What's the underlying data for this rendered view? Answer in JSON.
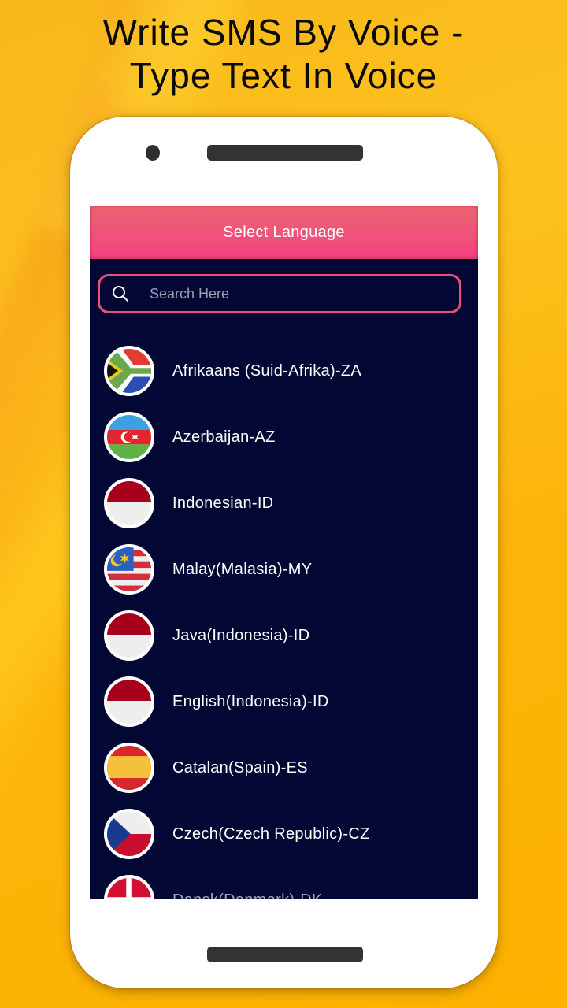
{
  "headline": {
    "line1": "Write SMS By Voice -",
    "line2": "Type Text In Voice"
  },
  "app": {
    "title": "Select Language",
    "search": {
      "placeholder": "Search Here",
      "value": "",
      "icon": "search-icon"
    },
    "languages": [
      {
        "label": "Afrikaans (Suid-Afrika)-ZA",
        "flag": "south-africa"
      },
      {
        "label": "Azerbaijan-AZ",
        "flag": "azerbaijan"
      },
      {
        "label": "Indonesian-ID",
        "flag": "indonesia"
      },
      {
        "label": "Malay(Malasia)-MY",
        "flag": "malaysia"
      },
      {
        "label": "Java(Indonesia)-ID",
        "flag": "indonesia"
      },
      {
        "label": "English(Indonesia)-ID",
        "flag": "indonesia"
      },
      {
        "label": "Catalan(Spain)-ES",
        "flag": "spain"
      },
      {
        "label": "Czech(Czech Republic)-CZ",
        "flag": "czech-republic"
      },
      {
        "label": "Dansk(Danmark)-DK",
        "flag": "denmark"
      }
    ]
  },
  "colors": {
    "background_yellow": "#fdb200",
    "header_pink": "#f04e7b",
    "search_border": "#ec4f78",
    "list_background": "#020833",
    "text_white": "#ffffff",
    "phone_frame": "#ffffff"
  }
}
